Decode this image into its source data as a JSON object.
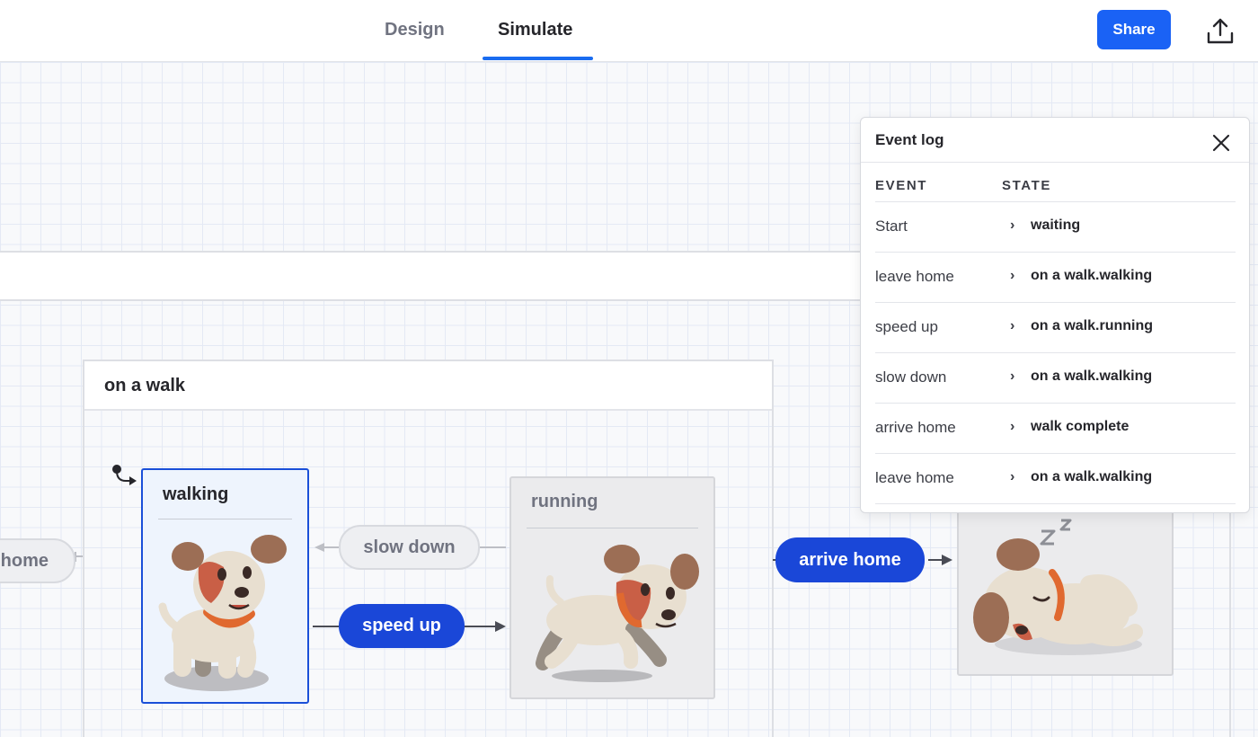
{
  "topbar": {
    "tabs": [
      {
        "label": "Design",
        "active": false
      },
      {
        "label": "Simulate",
        "active": true
      }
    ],
    "share_label": "Share",
    "export_icon": "upload-icon",
    "accent_color": "#1a6cf0"
  },
  "canvas": {
    "parent_state": "on a walk",
    "states": {
      "walking": {
        "label": "walking",
        "active": true
      },
      "running": {
        "label": "running",
        "active": false
      },
      "complete": {
        "label": "",
        "active": false
      }
    },
    "events": {
      "home": "home",
      "slow_down": "slow down",
      "speed_up": "speed up",
      "arrive_home": "arrive home"
    }
  },
  "event_log": {
    "title": "Event log",
    "close_icon": "close-icon",
    "columns": {
      "event": "EVENT",
      "state": "STATE"
    },
    "rows": [
      {
        "event": "Start",
        "state": "waiting"
      },
      {
        "event": "leave home",
        "state": "on a walk.walking"
      },
      {
        "event": "speed up",
        "state": "on a walk.running"
      },
      {
        "event": "slow down",
        "state": "on a walk.walking"
      },
      {
        "event": "arrive home",
        "state": "walk complete"
      },
      {
        "event": "leave home",
        "state": "on a walk.walking"
      }
    ]
  }
}
